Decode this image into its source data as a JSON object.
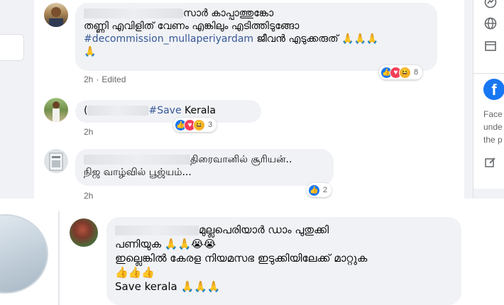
{
  "comments": [
    {
      "line1": "സാർ കാപ്പാത്തുങ്കോ",
      "line2": "തണ്ണി എവിളിത് വേണം എങ്കിലും എടിത്തിടുങ്ങോ",
      "hashtag": "#decommission_mullaperiyardam",
      "line3_rest": " ജീവൻ എടുക്കരുത് 🙏🙏🙏",
      "line4": "🙏",
      "time": "2h",
      "edited": "Edited",
      "reaction_count": "8"
    },
    {
      "prefix": "(",
      "hashtag": "#Save",
      "text": " Kerala",
      "time": "2h",
      "reaction_count": "3"
    },
    {
      "line1": "திரைவானில் சூரியன்..",
      "line2": "நிஜ வாழ்வில் பூஜ்யம்...",
      "time": "2h",
      "reaction_count": "2"
    },
    {
      "line1": "മുല്ലപെരിയാർ ഡാം പുതുക്കി",
      "line2": "പണിയുക 🙏🙏😭😭",
      "line3": "ഇല്ലെങ്കിൽ കേരള നിയമസഭ ഇടുക്കിയിലേക്ക് മാറ്റുക",
      "line4": "👍👍👍",
      "line5": "Save kerala 🙏🙏🙏"
    }
  ],
  "right_panel": {
    "text_lines": [
      "Face",
      "unde",
      "the p"
    ]
  },
  "icons": {
    "globe": "globe-icon",
    "book": "book-icon",
    "compose": "compose-icon",
    "messenger": "messenger-icon",
    "facebook_logo": "f"
  },
  "colors": {
    "like": "#1877f2",
    "love": "#f33e58",
    "haha": "#f7b125",
    "hashtag": "#385898",
    "bubble": "#f0f2f5",
    "meta": "#65676b"
  }
}
